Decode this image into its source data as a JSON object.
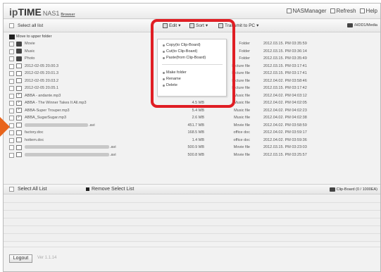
{
  "app": {
    "logo_ip": "ip",
    "logo_time": "TIME",
    "logo_nas": "NAS1",
    "logo_browser": "Browser",
    "links": [
      "NASManager",
      "Refresh",
      "Help"
    ]
  },
  "toolbar": {
    "select_all": "Select all list",
    "edit": "Edit",
    "sort": "Sort",
    "transmit": "Transmit to PC",
    "path": "/HDD1/Media"
  },
  "edit_menu": {
    "items": [
      "Copy(to Clip-Board)",
      "Cut(to Clip-Board)",
      "Paste(from Clip-Board)",
      "Make folder",
      "Rename",
      "Delete"
    ]
  },
  "files": [
    {
      "name": "Move to upper folder",
      "size": "",
      "type": "",
      "date": "",
      "icon": "up-folder-icon",
      "blur": false
    },
    {
      "name": "Movie",
      "size": "",
      "type": "Folder",
      "date": "2012.03.15. PM 03:35:59",
      "icon": "folder-icon",
      "blur": false
    },
    {
      "name": "Music",
      "size": "",
      "type": "Folder",
      "date": "2012.03.15. PM 03:36:14",
      "icon": "folder-icon",
      "blur": false
    },
    {
      "name": "Photo",
      "size": "",
      "type": "Folder",
      "date": "2012.03.15. PM 03:35:49",
      "icon": "folder-icon",
      "blur": false
    },
    {
      "name": "2012-02-05 20.00.3",
      "size": "467.1 KB",
      "type": "Picture file",
      "date": "2012.03.15. PM 03:17:41",
      "icon": "image-file-icon",
      "blur": false
    },
    {
      "name": "2012-02-05 20.01.3",
      "size": "458.1 KB",
      "type": "Picture file",
      "date": "2012.03.15. PM 03:17:41",
      "icon": "image-file-icon",
      "blur": false
    },
    {
      "name": "2012-02-05 20.03.2",
      "size": "491.9 KB",
      "type": "Picture file",
      "date": "2012.04.02. PM 03:58:46",
      "icon": "image-file-icon",
      "blur": false
    },
    {
      "name": "2012-02-05 20.05.1",
      "size": "457.9 KB",
      "type": "Picture file",
      "date": "2012.03.15. PM 03:17:42",
      "icon": "image-file-icon",
      "blur": false
    },
    {
      "name": "ABBA - andante.mp3",
      "size": "4.3 MB",
      "type": "Music file",
      "date": "2012.04.02. PM 04:03:12",
      "icon": "music-file-icon",
      "blur": false
    },
    {
      "name": "ABBA - The Winner Takes It All.mp3",
      "size": "4.5 MB",
      "type": "Music file",
      "date": "2012.04.02. PM 04:02:05",
      "icon": "music-file-icon",
      "blur": false
    },
    {
      "name": "ABBA-Super Trouper.mp3",
      "size": "5.4 MB",
      "type": "Music file",
      "date": "2012.04.02. PM 04:02:23",
      "icon": "music-file-icon",
      "blur": false
    },
    {
      "name": "ABBA_SugarSugar.mp3",
      "size": "2.6 MB",
      "type": "Music file",
      "date": "2012.04.02. PM 04:02:38",
      "icon": "music-file-icon",
      "blur": false
    },
    {
      "name": ".avi",
      "size": "451.7 MB",
      "type": "Movie file",
      "date": "2012.04.02. PM 03:58:59",
      "icon": "movie-file-icon",
      "blur": true
    },
    {
      "name": "factory.doc",
      "size": "168.5 MB",
      "type": "office doc",
      "date": "2012.04.02. PM 03:59:17",
      "icon": "doc-file-icon",
      "blur": false
    },
    {
      "name": "hottem.doc",
      "size": "1.4 MB",
      "type": "office doc",
      "date": "2012.04.02. PM 03:59:36",
      "icon": "doc-file-icon",
      "blur": false
    },
    {
      "name": ".avi",
      "size": "500.9 MB",
      "type": "Movie file",
      "date": "2012.03.15. PM 03:23:03",
      "icon": "movie-file-icon",
      "blur": true
    },
    {
      "name": ".avi",
      "size": "500.8 MB",
      "type": "Movie file",
      "date": "2012.03.15. PM 03:25:57",
      "icon": "movie-file-icon",
      "blur": true
    }
  ],
  "selection_bar": {
    "select_all": "Select All List",
    "remove": "Remove Select List",
    "clipboard": "Clip-Board (0 / 1000EA)"
  },
  "footer": {
    "logout": "Logout",
    "version": "Ver 1.1.14"
  },
  "colors": {
    "highlight": "#e01e24",
    "arrow": "#e8641c"
  }
}
